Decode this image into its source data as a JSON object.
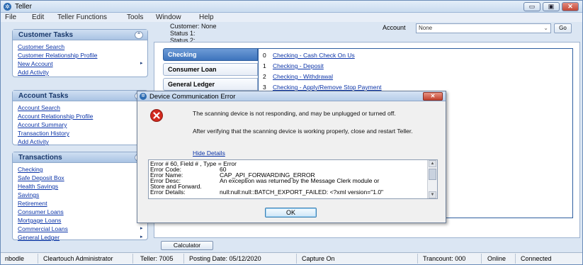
{
  "window": {
    "title": "Teller",
    "app_icon": "teller-logo-icon"
  },
  "menu": [
    "File",
    "Edit",
    "Teller Functions",
    "Tools",
    "Window",
    "Help"
  ],
  "customer_info": {
    "customer": "Customer:  None",
    "status1": "Status 1:",
    "status2": "Status 2:"
  },
  "account": {
    "label": "Account",
    "value": "None",
    "go": "Go"
  },
  "customer_tasks": {
    "title": "Customer Tasks",
    "items": [
      "Customer Search",
      "Customer Relationship Profile",
      "New Account",
      "Add Activity"
    ]
  },
  "account_tasks": {
    "title": "Account Tasks",
    "items": [
      "Account Search",
      "Account Relationship Profile",
      "Account Summary",
      "Transaction History",
      "Add Activity"
    ]
  },
  "transactions": {
    "title": "Transactions",
    "items": [
      "Checking",
      "Safe Deposit Box",
      "Health Savings",
      "Savings",
      "Retirement",
      "Consumer Loans",
      "Mortgage Loans",
      "Commercial Loans",
      "General Ledger"
    ]
  },
  "tabs": [
    "Checking",
    "Consumer Loan",
    "General Ledger"
  ],
  "checking_transactions": [
    {
      "num": "0",
      "label": "Checking - Cash Check On Us"
    },
    {
      "num": "1",
      "label": "Checking - Deposit"
    },
    {
      "num": "2",
      "label": "Checking - Withdrawal"
    },
    {
      "num": "3",
      "label": "Checking - Apply/Remove Stop Payment"
    }
  ],
  "calculator": "Calculator",
  "status_bar": {
    "user": "nbodle",
    "role": "Cleartouch Administrator",
    "teller": "Teller: 7005",
    "posting_date": "Posting Date: 05/12/2020",
    "capture": "Capture On",
    "trancount": "Trancount: 000",
    "online": "Online",
    "connected": "Connected"
  },
  "dialog": {
    "title": "Device Communication Error",
    "message1": "The scanning device is not responding, and may be unplugged or turned off.",
    "message2": "After verifying that the scanning device is working properly, close and restart Teller.",
    "hide_details": "Hide Details",
    "details": {
      "line1": "Error # 60, Field # , Type = Error",
      "code_label": "Error Code:",
      "code_value": "60",
      "name_label": "Error Name:",
      "name_value": "CAP_API_FORWARDING_ERROR",
      "desc_label": "Error Desc:",
      "desc_value": "An exception was returned by the Message Clerk module or",
      "desc_cont": "Store and Forward.",
      "details_label": "Error Details:",
      "details_value": "null:null:null::BATCH_EXPORT_FAILED: <?xml version=\"1.0\""
    },
    "ok": "OK",
    "close_icon": "close-icon",
    "error_icon": "error-icon"
  }
}
